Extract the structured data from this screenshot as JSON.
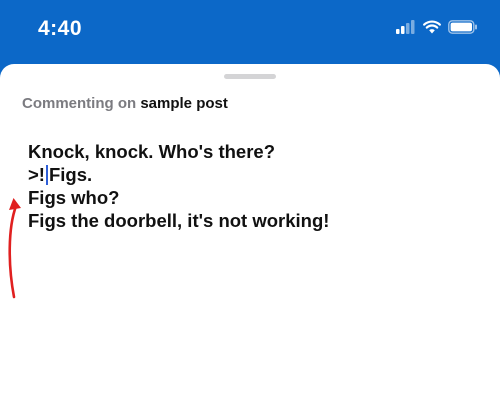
{
  "status_bar": {
    "time": "4:40",
    "icons": [
      "cellular-signal-icon",
      "wifi-icon",
      "battery-icon"
    ]
  },
  "colors": {
    "header_background": "#0c68c8",
    "sheet_background": "#ffffff",
    "caret": "#2f5fd8",
    "annotation_arrow": "#e02020"
  },
  "comment_sheet": {
    "prefix": "Commenting on",
    "post_name": "sample post",
    "editor": {
      "line1": "Knock, knock. Who's there?",
      "line2_before_caret": ">!",
      "line2_after_caret": "Figs.",
      "line3": "Figs who?",
      "line4": "Figs the doorbell, it's not working!"
    }
  }
}
